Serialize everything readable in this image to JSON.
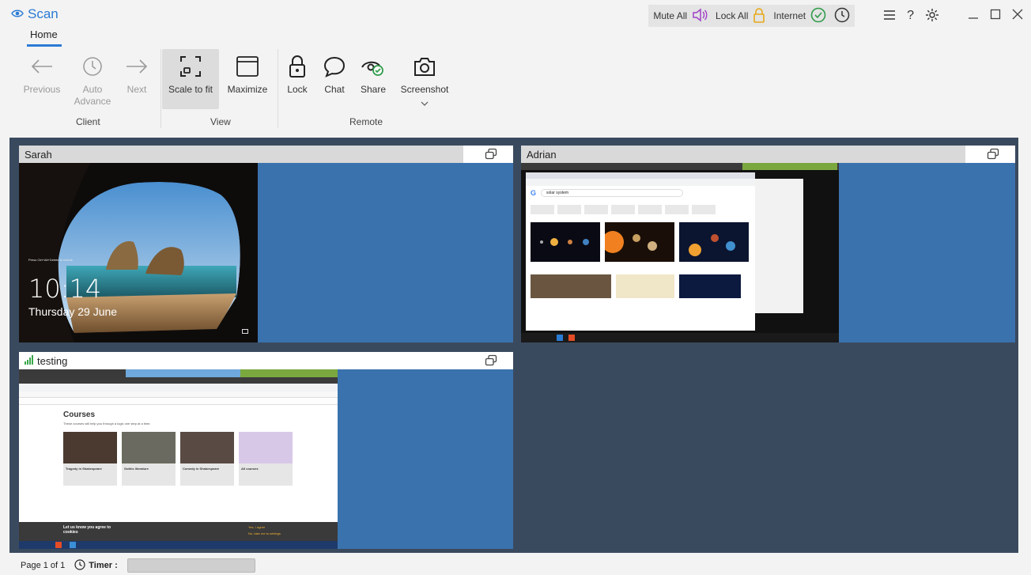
{
  "app": {
    "title": "Scan",
    "tab": "Home"
  },
  "topbar": {
    "mute_all": "Mute All",
    "lock_all": "Lock All",
    "internet": "Internet",
    "help": "?"
  },
  "ribbon": {
    "previous": "Previous",
    "auto_advance": "Auto Advance",
    "next": "Next",
    "scale_to_fit": "Scale to fit",
    "maximize": "Maximize",
    "lock": "Lock",
    "chat": "Chat",
    "share": "Share",
    "screenshot": "Screenshot",
    "groups": {
      "client": "Client",
      "view": "View",
      "remote": "Remote"
    }
  },
  "tiles": [
    {
      "name": "Sarah",
      "lock_time": "10:14",
      "lock_date": "Thursday 29 June",
      "lock_hint": "Press Ctrl+Alt+Delete to unlock."
    },
    {
      "name": "Adrian",
      "search_text": "solar system"
    },
    {
      "name": "testing",
      "courses_title": "Courses",
      "courses_sub": "These courses will help you through a logic one step at a time.",
      "courses": [
        "Tragedy in Shakespeare",
        "Gothic literature",
        "Comedy in Shakespeare",
        "All courses"
      ],
      "cookie_title": "Let us know you agree to cookies",
      "cookie_yes": "Yes, I agree",
      "cookie_no": "No, take me to settings"
    }
  ],
  "footer": {
    "page": "Page 1 of 1",
    "timer_label": "Timer :"
  },
  "colors": {
    "accent": "#2a7bd4",
    "tile_bg": "#3a72ad",
    "workspace_bg": "#3a4a5e"
  }
}
